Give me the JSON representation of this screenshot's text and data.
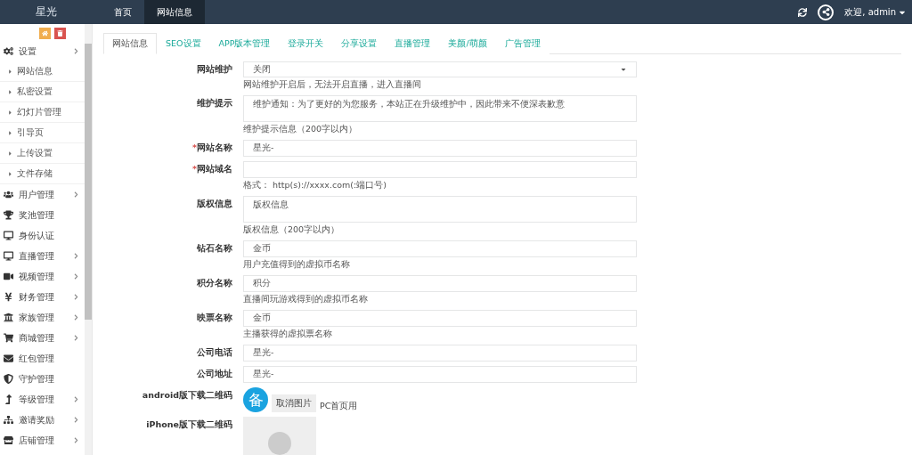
{
  "brand": "星光",
  "top_nav": [
    {
      "label": "首页",
      "selected": false
    },
    {
      "label": "网站信息",
      "selected": true
    }
  ],
  "user_menu": {
    "label": "欢迎, admin"
  },
  "sidebar": {
    "items": [
      {
        "label": "设置",
        "expanded": true,
        "has_children": true,
        "children": [
          {
            "label": "网站信息"
          },
          {
            "label": "私密设置"
          },
          {
            "label": "幻灯片管理"
          },
          {
            "label": "引导页"
          },
          {
            "label": "上传设置"
          },
          {
            "label": "文件存储"
          }
        ]
      },
      {
        "label": "用户管理",
        "expanded": false,
        "has_children": true
      },
      {
        "label": "奖池管理",
        "expanded": false,
        "has_children": false
      },
      {
        "label": "身份认证",
        "expanded": false,
        "has_children": false
      },
      {
        "label": "直播管理",
        "expanded": false,
        "has_children": true
      },
      {
        "label": "视频管理",
        "expanded": false,
        "has_children": true
      },
      {
        "label": "财务管理",
        "expanded": false,
        "has_children": true
      },
      {
        "label": "家族管理",
        "expanded": false,
        "has_children": true
      },
      {
        "label": "商城管理",
        "expanded": false,
        "has_children": true
      },
      {
        "label": "红包管理",
        "expanded": false,
        "has_children": false
      },
      {
        "label": "守护管理",
        "expanded": false,
        "has_children": false
      },
      {
        "label": "等级管理",
        "expanded": false,
        "has_children": true
      },
      {
        "label": "邀请奖励",
        "expanded": false,
        "has_children": true
      },
      {
        "label": "店铺管理",
        "expanded": false,
        "has_children": true
      }
    ]
  },
  "tabs": [
    {
      "label": "网站信息",
      "selected": true
    },
    {
      "label": "SEO设置",
      "selected": false
    },
    {
      "label": "APP版本管理",
      "selected": false
    },
    {
      "label": "登录开关",
      "selected": false
    },
    {
      "label": "分享设置",
      "selected": false
    },
    {
      "label": "直播管理",
      "selected": false
    },
    {
      "label": "美颜/萌颜",
      "selected": false
    },
    {
      "label": "广告管理",
      "selected": false
    }
  ],
  "form": [
    {
      "kind": "select",
      "label": "网站维护",
      "value": "关闭",
      "help": "网站维护开启后，无法开启直播，进入直播间"
    },
    {
      "kind": "textarea",
      "label": "维护提示",
      "value": "维护通知：为了更好的为您服务，本站正在升级维护中，因此带来不便深表歉意",
      "help": "维护提示信息（200字以内）"
    },
    {
      "kind": "input",
      "label": "网站名称",
      "required_mark": "*",
      "value": "星光-"
    },
    {
      "kind": "input",
      "label": "网站域名",
      "required_mark": "*",
      "help": "格式： http(s)://xxxx.com(:端口号)"
    },
    {
      "kind": "textarea",
      "label": "版权信息",
      "value": "版权信息",
      "help": "版权信息（200字以内）"
    },
    {
      "kind": "input",
      "label": "钻石名称",
      "value": "金币",
      "help": "用户充值得到的虚拟币名称"
    },
    {
      "kind": "input",
      "label": "积分名称",
      "value": "积分",
      "help": "直播间玩游戏得到的虚拟币名称"
    },
    {
      "kind": "input",
      "label": "映票名称",
      "value": "金币",
      "help": "主播获得的虚拟票名称"
    },
    {
      "kind": "input",
      "label": "公司电话",
      "value": "星光-"
    },
    {
      "kind": "input",
      "label": "公司地址",
      "value": "星光-"
    },
    {
      "kind": "image",
      "label": "android版下载二维码",
      "badge_text": "备",
      "button": "取消图片",
      "note": "PC首页用"
    },
    {
      "kind": "image",
      "label": "iPhone版下载二维码"
    }
  ]
}
